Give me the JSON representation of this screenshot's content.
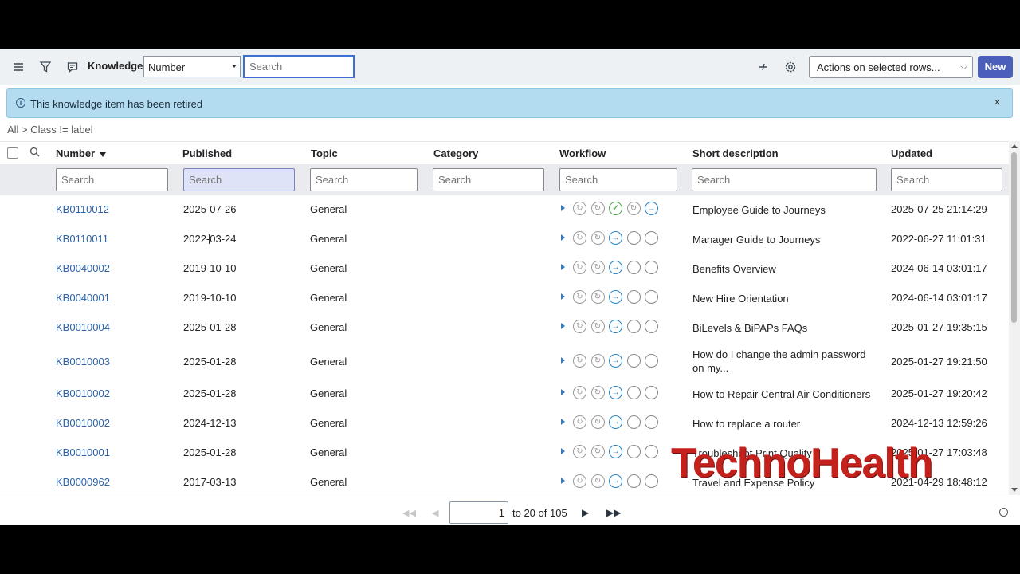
{
  "toolbar": {
    "list_label": "Knowledge",
    "field_select": "Number",
    "search_placeholder": "Search",
    "actions_select": "Actions on selected rows...",
    "new_label": "New",
    "icons": [
      "menu-icon",
      "filter-icon",
      "chat-icon",
      "pin-icon",
      "gear-icon"
    ]
  },
  "banner": {
    "message": "This knowledge item has been retired",
    "close": "×"
  },
  "breadcrumb": "All > Class != label",
  "columns": {
    "number": "Number",
    "published": "Published",
    "topic": "Topic",
    "category": "Category",
    "workflow": "Workflow",
    "short_description": "Short description",
    "updated": "Updated"
  },
  "filter_placeholder": "Search",
  "rows": [
    {
      "number": "KB0110012",
      "published": "2025-07-26",
      "topic": "General",
      "category": "",
      "workflow": [
        "skipped",
        "skipped",
        "done",
        "skipped",
        "current"
      ],
      "short_description": "Employee Guide to Journeys",
      "updated": "2025-07-25 21:14:29"
    },
    {
      "number": "KB0110011",
      "published": "2022-03-24",
      "topic": "General",
      "category": "",
      "workflow": [
        "skipped",
        "skipped",
        "current",
        "empty",
        "empty"
      ],
      "short_description": "Manager Guide to Journeys",
      "updated": "2022-06-27 11:01:31"
    },
    {
      "number": "KB0040002",
      "published": "2019-10-10",
      "topic": "General",
      "category": "",
      "workflow": [
        "skipped",
        "skipped",
        "current",
        "empty",
        "empty"
      ],
      "short_description": "Benefits Overview",
      "updated": "2024-06-14 03:01:17"
    },
    {
      "number": "KB0040001",
      "published": "2019-10-10",
      "topic": "General",
      "category": "",
      "workflow": [
        "skipped",
        "skipped",
        "current",
        "empty",
        "empty"
      ],
      "short_description": "New Hire Orientation",
      "updated": "2024-06-14 03:01:17"
    },
    {
      "number": "KB0010004",
      "published": "2025-01-28",
      "topic": "General",
      "category": "",
      "workflow": [
        "skipped",
        "skipped",
        "current",
        "empty",
        "empty"
      ],
      "short_description": "BiLevels & BiPAPs FAQs",
      "updated": "2025-01-27 19:35:15"
    },
    {
      "number": "KB0010003",
      "published": "2025-01-28",
      "topic": "General",
      "category": "",
      "workflow": [
        "skipped",
        "skipped",
        "current",
        "empty",
        "empty"
      ],
      "short_description": "How do I change the admin password on my...",
      "updated": "2025-01-27 19:21:50"
    },
    {
      "number": "KB0010002",
      "published": "2025-01-28",
      "topic": "General",
      "category": "",
      "workflow": [
        "skipped",
        "skipped",
        "current",
        "empty",
        "empty"
      ],
      "short_description": "How to Repair Central Air Conditioners",
      "updated": "2025-01-27 19:20:42"
    },
    {
      "number": "KB0010002",
      "published": "2024-12-13",
      "topic": "General",
      "category": "",
      "workflow": [
        "skipped",
        "skipped",
        "current",
        "empty",
        "empty"
      ],
      "short_description": "How to replace a router",
      "updated": "2024-12-13 12:59:26"
    },
    {
      "number": "KB0010001",
      "published": "2025-01-28",
      "topic": "General",
      "category": "",
      "workflow": [
        "skipped",
        "skipped",
        "current",
        "empty",
        "empty"
      ],
      "short_description": "Troubleshoot Print Quality",
      "updated": "2025-01-27 17:03:48"
    },
    {
      "number": "KB0000962",
      "published": "2017-03-13",
      "topic": "General",
      "category": "",
      "workflow": [
        "skipped",
        "skipped",
        "current",
        "empty",
        "empty"
      ],
      "short_description": "Travel and Expense Policy",
      "updated": "2021-04-29 18:48:12"
    }
  ],
  "pagination": {
    "current_page": "1",
    "range_text": "to 20 of 105"
  },
  "watermark": "TechnoHealth",
  "colors": {
    "accent": "#4b5eba",
    "link": "#2c62a8",
    "banner_bg": "#b3dcf1",
    "stage_done": "#55a84f",
    "stage_current": "#2a86c8"
  }
}
